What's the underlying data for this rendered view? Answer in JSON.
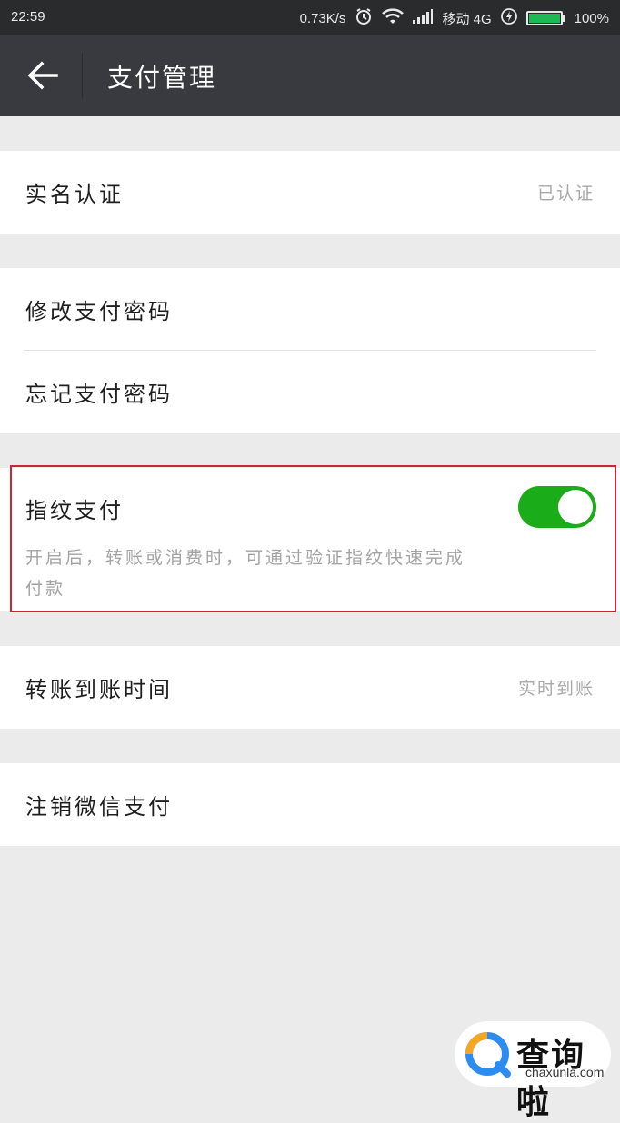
{
  "status_bar": {
    "time": "22:59",
    "net_speed": "0.73K/s",
    "carrier": "移动 4G",
    "battery": "100%",
    "battery_level": 1.0
  },
  "header": {
    "title": "支付管理",
    "back_icon": "arrow-left-icon"
  },
  "sections": {
    "verification": {
      "label": "实名认证",
      "value": "已认证"
    },
    "change_password": {
      "label": "修改支付密码"
    },
    "forgot_password": {
      "label": "忘记支付密码"
    },
    "fingerprint": {
      "label": "指纹支付",
      "description": "开启后，转账或消费时，可通过验证指纹快速完成付款",
      "enabled": true
    },
    "transfer_time": {
      "label": "转账到账时间",
      "value": "实时到账"
    },
    "deactivate": {
      "label": "注销微信支付"
    }
  },
  "colors": {
    "toggle_on": "#1aad19",
    "highlight_border": "#c9263a",
    "header_bg": "#393a3f"
  },
  "watermark": {
    "cn": "查询啦",
    "en": "chaxunla.com"
  }
}
